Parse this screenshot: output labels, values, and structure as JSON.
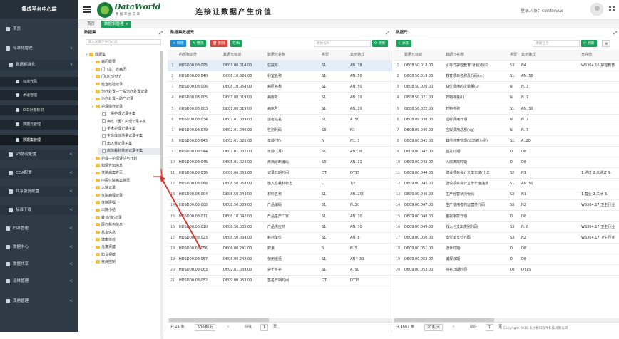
{
  "sidebar": {
    "title": "集成平台中心端",
    "items": [
      {
        "label": "首页",
        "level": 1,
        "arrow": ""
      },
      {
        "label": "标准化管理",
        "level": 1,
        "arrow": "∨"
      },
      {
        "label": "数据标准化",
        "level": 2,
        "arrow": "∨"
      },
      {
        "label": "标准代码",
        "level": 3,
        "arrow": ""
      },
      {
        "label": "术语管理",
        "level": 3,
        "arrow": ""
      },
      {
        "label": "OID对象标识",
        "level": 3,
        "arrow": ""
      },
      {
        "label": "数据元管理",
        "level": 3,
        "arrow": ""
      },
      {
        "label": "数据集管理",
        "level": 3,
        "arrow": ""
      },
      {
        "label": "V3协议配置",
        "level": 2,
        "arrow": "<"
      },
      {
        "label": "CDA配置",
        "level": 2,
        "arrow": "<"
      },
      {
        "label": "共享服务配置",
        "level": 2,
        "arrow": "<"
      },
      {
        "label": "标准下载",
        "level": 2,
        "arrow": "<"
      },
      {
        "label": "ESB管理",
        "level": 1,
        "arrow": "<"
      },
      {
        "label": "数据中心",
        "level": 1,
        "arrow": "<"
      },
      {
        "label": "数据共享",
        "level": 1,
        "arrow": "<"
      },
      {
        "label": "运维管理",
        "level": 1,
        "arrow": "<"
      },
      {
        "label": "其他管理",
        "level": 1,
        "arrow": "<"
      }
    ]
  },
  "header": {
    "logo_main": "DataWorld",
    "logo_sub": "数 据 开 创 未 来",
    "slogan": "连接让数据产生价值",
    "login_label": "登录人员：centervue"
  },
  "tabs": {
    "home": "首页",
    "active": "数据集管理 ×"
  },
  "tree": {
    "title": "数据集",
    "search_placeholder": "输入关键字进行过滤",
    "nodes": [
      {
        "label": "数据集",
        "depth": 0,
        "type": "folder",
        "caret": "▾"
      },
      {
        "label": "病历概要",
        "depth": 1,
        "type": "folder",
        "caret": "›"
      },
      {
        "label": "门（急）诊病历",
        "depth": 1,
        "type": "folder",
        "caret": "›"
      },
      {
        "label": "门(急)诊处方",
        "depth": 1,
        "type": "folder",
        "caret": "›"
      },
      {
        "label": "检查检验记录",
        "depth": 1,
        "type": "folder",
        "caret": "›"
      },
      {
        "label": "治疗处置—一般治疗处置记录",
        "depth": 1,
        "type": "folder",
        "caret": "›"
      },
      {
        "label": "治疗处置—助产记录",
        "depth": 1,
        "type": "folder",
        "caret": "›"
      },
      {
        "label": "护理操作记录",
        "depth": 1,
        "type": "folder",
        "caret": "▾"
      },
      {
        "label": "一般护理记录子集",
        "depth": 2,
        "type": "file",
        "caret": ""
      },
      {
        "label": "病危（重）护理记录子集",
        "depth": 2,
        "type": "file",
        "caret": ""
      },
      {
        "label": "手术护理记录子集",
        "depth": 2,
        "type": "file",
        "caret": ""
      },
      {
        "label": "生命体征测量记录子集",
        "depth": 2,
        "type": "file",
        "caret": ""
      },
      {
        "label": "出入量记录子集",
        "depth": 2,
        "type": "file",
        "caret": ""
      },
      {
        "label": "高值耗材使用记录子集",
        "depth": 2,
        "type": "file",
        "caret": ""
      },
      {
        "label": "护理—护理评估与计划",
        "depth": 1,
        "type": "folder",
        "caret": "›"
      },
      {
        "label": "知情告知信息",
        "depth": 1,
        "type": "folder",
        "caret": "›"
      },
      {
        "label": "住院病案首页",
        "depth": 1,
        "type": "folder",
        "caret": "›"
      },
      {
        "label": "中医住院病案首页",
        "depth": 1,
        "type": "folder",
        "caret": "›"
      },
      {
        "label": "入院记录",
        "depth": 1,
        "type": "folder",
        "caret": "›"
      },
      {
        "label": "住院病程记录",
        "depth": 1,
        "type": "folder",
        "caret": "›"
      },
      {
        "label": "住院医嘱",
        "depth": 1,
        "type": "folder",
        "caret": "›"
      },
      {
        "label": "出院小结",
        "depth": 1,
        "type": "folder",
        "caret": "›"
      },
      {
        "label": "转诊(院)记录",
        "depth": 1,
        "type": "folder",
        "caret": "›"
      },
      {
        "label": "医疗机构信息",
        "depth": 1,
        "type": "folder",
        "caret": "›"
      },
      {
        "label": "基本信息",
        "depth": 1,
        "type": "folder",
        "caret": "›"
      },
      {
        "label": "健康体检",
        "depth": 1,
        "type": "folder",
        "caret": "›"
      },
      {
        "label": "儿童保健",
        "depth": 1,
        "type": "folder",
        "caret": "›"
      },
      {
        "label": "妇女保健",
        "depth": 1,
        "type": "folder",
        "caret": "›"
      },
      {
        "label": "疾病控制",
        "depth": 1,
        "type": "folder",
        "caret": "›"
      }
    ]
  },
  "set_panel": {
    "title": "数据集数据元",
    "toolbar": {
      "add": "+ 新增",
      "edit": "✎ 修改",
      "delete": "🗑 删除",
      "import": "导出",
      "search_placeholder": "模糊名称",
      "refresh": "⟳ 刷新"
    },
    "columns": [
      "",
      "内部标识符",
      "数据元标识",
      "数据元名称",
      "类型",
      "表示格式"
    ],
    "rows": [
      [
        "1",
        "HDSD00.08.095",
        "DE01.00.014.00",
        "住院号",
        "S1",
        "AN..18"
      ],
      [
        "2",
        "HDSD00.08.040",
        "DE08.10.026.00",
        "科室名称",
        "S1",
        "AN..50"
      ],
      [
        "3",
        "HDSD00.08.006",
        "DE08.10.054.00",
        "病区名称",
        "S1",
        "AN..50"
      ],
      [
        "4",
        "HDSD00.08.005",
        "DE01.00.019.00",
        "病房号",
        "S1",
        "AN..10"
      ],
      [
        "5",
        "HDSD00.08.003",
        "DE01.00.019.00",
        "病床号",
        "S1",
        "AN..10"
      ],
      [
        "6",
        "HDSD00.08.034",
        "DE02.01.039.00",
        "患者姓名",
        "S1",
        "A..50"
      ],
      [
        "7",
        "HDSD00.08.079",
        "DE02.01.040.00",
        "性别代码",
        "S3",
        "N1"
      ],
      [
        "8",
        "HDSD00.08.043",
        "DE02.01.026.00",
        "年龄(岁)",
        "N",
        "N1..3"
      ],
      [
        "9",
        "HDSD00.08.044",
        "DE02.01.032.00",
        "年龄（月）",
        "S1",
        "AN^ 8"
      ],
      [
        "10",
        "HDSD00.08.045",
        "DE05.01.024.00",
        "疾病诊断编码",
        "S3",
        "AN..11"
      ],
      [
        "11",
        "HDSD00.08.036",
        "DE09.00.053.00",
        "记录日期时间",
        "DT",
        "DT15"
      ],
      [
        "12",
        "HDSD00.08.068",
        "DE08.50.058.00",
        "植入性耗材标志",
        "L",
        "T/F"
      ],
      [
        "13",
        "HDSD00.08.004",
        "DE08.50.044.00",
        "材料名称",
        "S1",
        "AN..200"
      ],
      [
        "14",
        "HDSD00.08.008",
        "DE08.50.039.00",
        "产品编码",
        "S1",
        "N..20"
      ],
      [
        "15",
        "HDSD00.08.011",
        "DE08.10.042.00",
        "产品生产厂家",
        "S1",
        "AN..70"
      ],
      [
        "16",
        "HDSD00.08.010",
        "DE08.50.035.00",
        "产品供应商",
        "S1",
        "AN..70"
      ],
      [
        "17",
        "HDSD00.08.023",
        "DE08.50.034.00",
        "耗材单位",
        "S1",
        "AN..8"
      ],
      [
        "18",
        "HDSD00.08.056",
        "DE06.00.241.00",
        "数量",
        "N",
        "N..5"
      ],
      [
        "19",
        "HDSD00.08.057",
        "DE06.00.242.00",
        "使用途径",
        "S1",
        "AN^ 30"
      ],
      [
        "20",
        "HDSD00.08.063",
        "DE02.01.039.00",
        "护士签名",
        "S1",
        "A..50"
      ],
      [
        "21",
        "HDSD00.08.052",
        "DE09.00.053.00",
        "签名日期时间",
        "DT",
        "DT15"
      ]
    ],
    "footer": {
      "total": "共 21 条",
      "page_size": "500条/页",
      "prev": "‹",
      "page_prefix": "前往",
      "page": "1",
      "page_suffix": "页"
    }
  },
  "element_panel": {
    "title": "数据元",
    "toolbar": {
      "add": "+ 添加",
      "search_placeholder": "模糊名称",
      "refresh": "⟳ 刷新"
    },
    "columns": [
      "",
      "数据元标识",
      "数据元名称",
      "类型",
      "表示格式",
      "允许值"
    ],
    "rows": [
      [
        "1",
        "DE08.50.018.00",
        "引导式护理教育(计划)标识",
        "S3",
        "N4",
        "WS364.16 护理教育"
      ],
      [
        "2",
        "DE08.50.019.00",
        "教育项目名称及代码(人)",
        "S1",
        "AN..50",
        ""
      ],
      [
        "3",
        "DE08.50.020.00",
        "缺位费用的次数量(U)",
        "N",
        "N..3",
        ""
      ],
      [
        "4",
        "DE08.50.021.00",
        "药物存量(I)",
        "N",
        "N..7",
        ""
      ],
      [
        "5",
        "DE08.50.022.00",
        "药物名称",
        "S1",
        "AN..50",
        ""
      ],
      [
        "6",
        "DE08.09.038.00",
        "应收费用日期",
        "N",
        "N..7",
        ""
      ],
      [
        "7",
        "DE08.09.040.00",
        "应收费用总额(kg)",
        "N",
        "N..7",
        ""
      ],
      [
        "8",
        "DE09.00.041.00",
        "其他注意管理(以患者为例)",
        "S1",
        "A..20",
        ""
      ],
      [
        "9",
        "DE09.00.042.00",
        "签发时期",
        "D",
        "D8",
        ""
      ],
      [
        "10",
        "DE09.00.043.00",
        "入院离院时期",
        "D",
        "D8",
        ""
      ],
      [
        "11",
        "DE09.00.044.00",
        "建设项目会计立年年度(上年",
        "S2",
        "N1",
        "1.通过 2.未通过 9."
      ],
      [
        "12",
        "DE09.00.045.00",
        "建设项目会计立年年度描述",
        "S1",
        "AN..50",
        ""
      ],
      [
        "13",
        "DE09.00.046.00",
        "生产经营状况代码",
        "S3",
        "N1",
        "1.营业 2.关闭 3."
      ],
      [
        "14",
        "DE09.00.047.00",
        "生产使用者的运营类代码",
        "S3",
        "N2",
        "WS364.17 卫生行业"
      ],
      [
        "15",
        "DE09.00.048.00",
        "备报条款日期",
        "D",
        "D8",
        ""
      ],
      [
        "16",
        "DE09.00.049.00",
        "收入与支出类别代码",
        "S3",
        "N..6",
        "WS364.17 卫生行业"
      ],
      [
        "17",
        "DE09.00.050.00",
        "支付单支付代码",
        "S3",
        "N2",
        "WS364.17 卫生行业"
      ],
      [
        "18",
        "DE09.00.051.00",
        "逝世时期",
        "D",
        "D8",
        ""
      ],
      [
        "19",
        "DE09.00.052.00",
        "编报日期",
        "D",
        "D8",
        ""
      ],
      [
        "20",
        "DE09.00.053.00",
        "签名日期时间",
        "DT",
        "DT15",
        ""
      ]
    ],
    "footer": {
      "total": "共 1667 条",
      "page_size": "20条/页",
      "prev": "‹",
      "page_prefix": "前往",
      "page": "1",
      "page_suffix": "页"
    }
  },
  "copyright": "© Copyright 2018 长沙赛讯软件科技有限公司"
}
